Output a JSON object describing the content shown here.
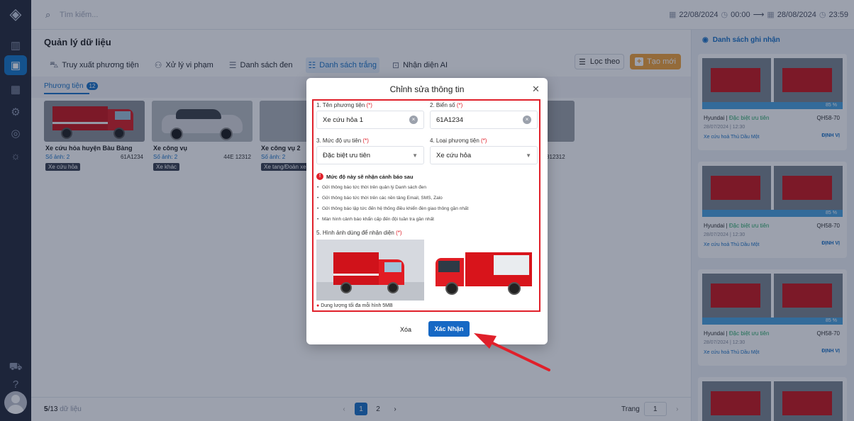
{
  "topbar": {
    "search_placeholder": "Tìm kiếm...",
    "date_from": "22/08/2024",
    "time_from": "00:00",
    "arrow": "⟶",
    "date_to": "28/08/2024",
    "time_to": "23:59"
  },
  "page": {
    "title": "Quản lý dữ liệu",
    "tabs": [
      {
        "label": "Truy xuất phương tiện",
        "icon": "car-icon"
      },
      {
        "label": "Xử lý vi phạm",
        "icon": "users-icon"
      },
      {
        "label": "Danh sách đen",
        "icon": "list-icon"
      },
      {
        "label": "Danh sách trắng",
        "icon": "list-check-icon",
        "active": true
      },
      {
        "label": "Nhận diện AI",
        "icon": "ai-icon"
      }
    ],
    "filter_label": "Lọc theo",
    "create_label": "Tạo mới",
    "subtab_label": "Phương tiện",
    "subtab_count": "12"
  },
  "cards": [
    {
      "title": "Xe cứu hỏa huyện Bàu Bàng",
      "sub": "Số ảnh: 2",
      "plate": "61A1234",
      "tag": "Xe cứu hỏa"
    },
    {
      "title": "Xe công vụ",
      "sub": "Số ảnh: 2",
      "plate": "44E 12312",
      "tag": "Xe khác"
    },
    {
      "title": "Xe công vụ 2",
      "sub": "Số ảnh: 2",
      "plate": "",
      "tag": "Xe tang/Đoàn xe tang"
    },
    {
      "title": "",
      "sub": "",
      "plate": "312312",
      "tag": ""
    }
  ],
  "footer": {
    "count_current": "5",
    "count_total": "/13",
    "count_label": "dữ liệu",
    "pages": [
      "1",
      "2"
    ],
    "page_label": "Trang",
    "page_value": "1"
  },
  "right_panel": {
    "title": "Danh sách ghi nhận",
    "items": [
      {
        "pct": "85 %",
        "brand": "Hyundai",
        "sep": " | ",
        "priority": "Đặc biệt ưu tiên",
        "plate": "QH58-70",
        "time": "28/07/2024 | 12:30",
        "type": "Xe cứu hoả   Thủ Dầu Một",
        "locate": "ĐỊNH VỊ"
      },
      {
        "pct": "85 %",
        "brand": "Hyundai",
        "sep": " | ",
        "priority": "Đặc biệt ưu tiên",
        "plate": "QH58-70",
        "time": "28/07/2024 | 12:30",
        "type": "Xe cứu hoả   Thủ Dầu Một",
        "locate": "ĐỊNH VỊ"
      },
      {
        "pct": "85 %",
        "brand": "Hyundai",
        "sep": " | ",
        "priority": "Đặc biệt ưu tiên",
        "plate": "QH58-70",
        "time": "28/07/2024 | 12:30",
        "type": "Xe cứu hoả   Thủ Dầu Một",
        "locate": "ĐỊNH VỊ"
      }
    ]
  },
  "modal": {
    "title": "Chỉnh sửa thông tin",
    "f1_label": "1. Tên phương tiện",
    "f1_value": "Xe cứu hỏa 1",
    "f2_label": "2. Biển số",
    "f2_value": "61A1234",
    "f3_label": "3. Mức độ ưu tiên",
    "f3_value": "Đặc biệt ưu tiên",
    "f4_label": "4. Loại phương tiện",
    "f4_value": "Xe cứu hỏa",
    "req_mark": "(*)",
    "warning": "Mức độ này sẽ nhận cảnh báo sau",
    "bullets": [
      "Gửi thông báo tức thời trên quản lý Danh sách đen",
      "Gửi thông báo tức thời trên các nền tảng Email, SMS, Zalo",
      "Gửi thông báo lập tức đến hệ thống điều khiển đèn giao thông gần nhất",
      "Màn hình cảnh báo khẩn cấp đến đội tuần tra gần nhất"
    ],
    "f5_label": "5. Hình ảnh dùng để nhận diện",
    "note": "Dung lượng tối đa mỗi hình 5MB",
    "delete_label": "Xóa",
    "confirm_label": "Xác Nhận"
  },
  "colors": {
    "accent": "#1a73c7",
    "highlight": "#e0202a",
    "create": "#f2a23a"
  }
}
